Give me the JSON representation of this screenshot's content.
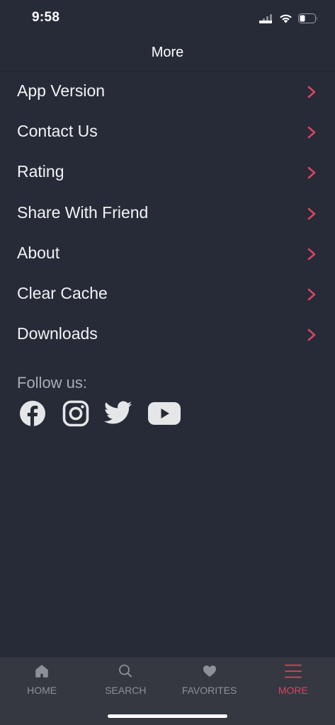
{
  "status_bar": {
    "time": "9:58"
  },
  "header": {
    "title": "More"
  },
  "menu": {
    "items": [
      {
        "label": "App Version"
      },
      {
        "label": "Contact Us"
      },
      {
        "label": "Rating"
      },
      {
        "label": "Share With Friend"
      },
      {
        "label": "About"
      },
      {
        "label": "Clear Cache"
      },
      {
        "label": "Downloads"
      }
    ]
  },
  "follow": {
    "label": "Follow us:",
    "icons": [
      "facebook-icon",
      "instagram-icon",
      "twitter-icon",
      "youtube-icon"
    ]
  },
  "tab_bar": {
    "tabs": [
      {
        "label": "HOME",
        "icon": "home-icon",
        "active": false
      },
      {
        "label": "SEARCH",
        "icon": "search-icon",
        "active": false
      },
      {
        "label": "FAVORITES",
        "icon": "heart-icon",
        "active": false
      },
      {
        "label": "MORE",
        "icon": "menu-icon",
        "active": true
      }
    ]
  },
  "colors": {
    "background": "#262b37",
    "tab_bar": "#353841",
    "accent": "#d6465f",
    "inactive": "#8d9098",
    "muted_text": "#a9acb3",
    "social_icons": "#e5e6e8"
  }
}
